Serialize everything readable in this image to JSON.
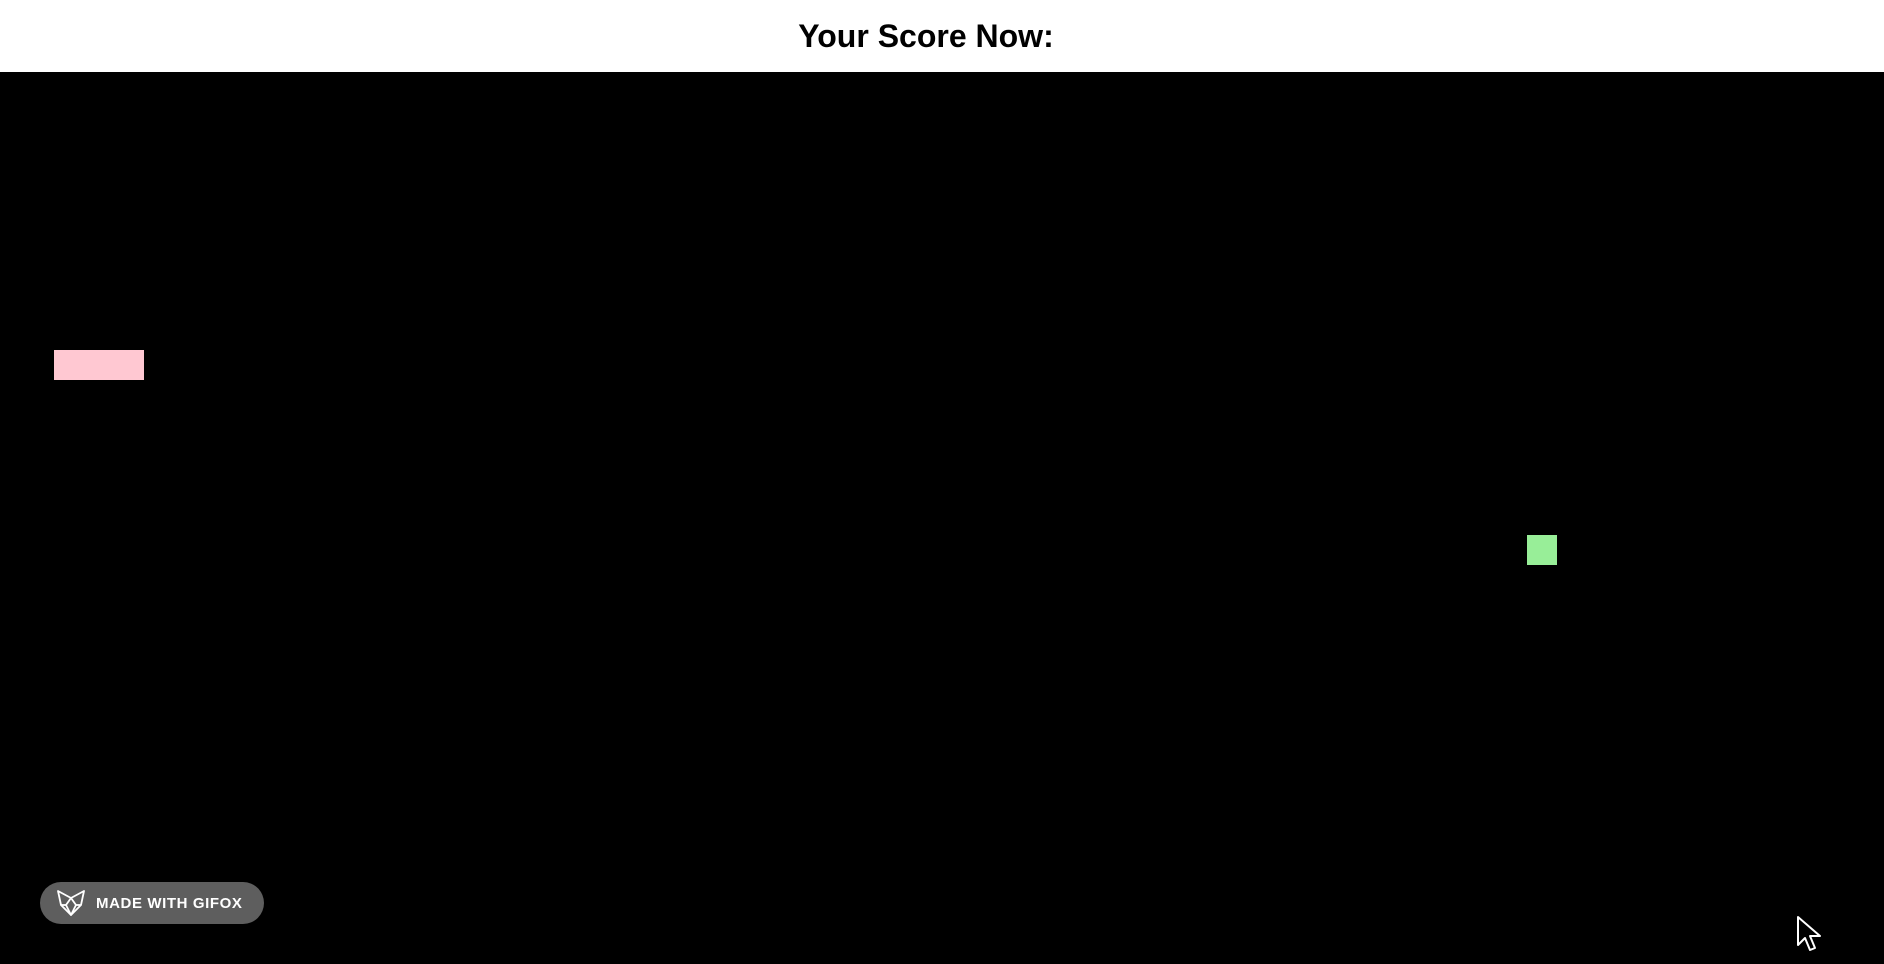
{
  "header": {
    "title": "Your Score Now:"
  },
  "game": {
    "background_color": "#000000",
    "snake_color": "#ffc8d2",
    "food_color": "#98ee98"
  },
  "watermark": {
    "label": "MADE WITH GIFOX",
    "icon": "fox-icon"
  },
  "cursor": {
    "icon": "pointer-cursor-icon"
  }
}
